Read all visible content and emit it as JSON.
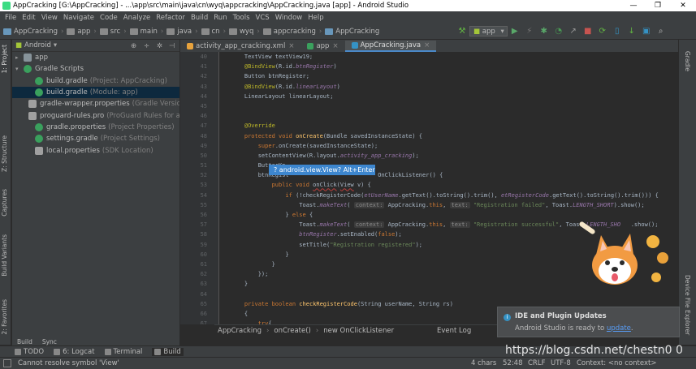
{
  "window": {
    "title": "AppCracking [G:\\AppCracking] - ...\\app\\src\\main\\java\\cn\\wyq\\appcracking\\AppCracking.java [app] - Android Studio",
    "controls": [
      "—",
      "❐",
      "✕"
    ]
  },
  "menu": [
    "File",
    "Edit",
    "View",
    "Navigate",
    "Code",
    "Analyze",
    "Refactor",
    "Build",
    "Run",
    "Tools",
    "VCS",
    "Window",
    "Help"
  ],
  "breadcrumbs": [
    "AppCracking",
    "app",
    "src",
    "main",
    "java",
    "cn",
    "wyq",
    "appcracking",
    "AppCracking"
  ],
  "toolbar": {
    "run_config": "app"
  },
  "project_panel": {
    "view_selector": "Android",
    "tree": [
      {
        "label": "app",
        "sub": "",
        "icon": "folder-icon",
        "indent": 0
      },
      {
        "label": "Gradle Scripts",
        "sub": "",
        "icon": "gradle-icon",
        "indent": 0
      },
      {
        "label": "build.gradle",
        "sub": "(Project: AppCracking)",
        "icon": "gradle-icon",
        "indent": 1
      },
      {
        "label": "build.gradle",
        "sub": "(Module: app)",
        "icon": "gradle-icon",
        "indent": 1
      },
      {
        "label": "gradle-wrapper.properties",
        "sub": "(Gradle Version)",
        "icon": "properties-icon",
        "indent": 1
      },
      {
        "label": "proguard-rules.pro",
        "sub": "(ProGuard Rules for ap",
        "icon": "file-icon",
        "indent": 1
      },
      {
        "label": "gradle.properties",
        "sub": "(Project Properties)",
        "icon": "gradle-icon",
        "indent": 1
      },
      {
        "label": "settings.gradle",
        "sub": "(Project Settings)",
        "icon": "gradle-icon",
        "indent": 1
      },
      {
        "label": "local.properties",
        "sub": "(SDK Location)",
        "icon": "properties-icon",
        "indent": 1
      }
    ],
    "selected_index": 3
  },
  "left_stripe": [
    "1: Project",
    "Z: Structure",
    "Captures",
    "Build Variants",
    "2: Favorites"
  ],
  "right_stripe": [
    "Gradle",
    "Device File Explorer"
  ],
  "build_strip": [
    "Build",
    "Sync"
  ],
  "editor_tabs": [
    {
      "label": "activity_app_cracking.xml",
      "active": false
    },
    {
      "label": "app",
      "active": false
    },
    {
      "label": "AppCracking.java",
      "active": true
    }
  ],
  "line_numbers": [
    "40",
    "41",
    "42",
    "43",
    "44",
    "45",
    "46",
    "47",
    "48",
    "49",
    "50",
    "51",
    "52",
    "53",
    "54",
    "55",
    "56",
    "57",
    "58",
    "59",
    "60",
    "61",
    "62",
    "63",
    "64",
    "65",
    "66",
    "67"
  ],
  "code_lines": [
    [
      {
        "t": "    TextView textView19;",
        "c": ""
      }
    ],
    [
      {
        "t": "    @BindView",
        "c": "ann"
      },
      {
        "t": "(R.id.",
        "c": ""
      },
      {
        "t": "btnRegister",
        "c": "id"
      },
      {
        "t": ")",
        "c": ""
      }
    ],
    [
      {
        "t": "    Button btnRegister;",
        "c": ""
      }
    ],
    [
      {
        "t": "    @BindView",
        "c": "ann"
      },
      {
        "t": "(R.id.",
        "c": ""
      },
      {
        "t": "linearLayout",
        "c": "id"
      },
      {
        "t": ")",
        "c": ""
      }
    ],
    [
      {
        "t": "    LinearLayout linearLayout;",
        "c": ""
      }
    ],
    [
      {
        "t": "",
        "c": ""
      }
    ],
    [
      {
        "t": "",
        "c": ""
      }
    ],
    [
      {
        "t": "    @Override",
        "c": "ann"
      }
    ],
    [
      {
        "t": "    protected void ",
        "c": "kw"
      },
      {
        "t": "onCreate",
        "c": "fn"
      },
      {
        "t": "(Bundle savedInstanceState) {",
        "c": ""
      }
    ],
    [
      {
        "t": "        super",
        "c": "kw"
      },
      {
        "t": ".onCreate(savedInstanceState);",
        "c": ""
      }
    ],
    [
      {
        "t": "        setContentView(R.layout.",
        "c": ""
      },
      {
        "t": "activity_app_cracking",
        "c": "id"
      },
      {
        "t": ");",
        "c": ""
      }
    ],
    [
      {
        "t": "        ButterKn",
        "c": ""
      }
    ],
    [
      {
        "t": "        btnRegist",
        "c": ""
      },
      {
        "t": "                          ",
        "c": ""
      },
      {
        "t": "OnClickListener() {",
        "c": ""
      }
    ],
    [
      {
        "t": "            public void ",
        "c": "kw"
      },
      {
        "t": "onClick",
        "c": "err"
      },
      {
        "t": "(",
        "c": ""
      },
      {
        "t": "View",
        "c": "err"
      },
      {
        "t": " v) {",
        "c": ""
      }
    ],
    [
      {
        "t": "                if ",
        "c": "kw"
      },
      {
        "t": "(!checkRegisterCode(",
        "c": ""
      },
      {
        "t": "etUserName",
        "c": "id"
      },
      {
        "t": ".getText().toString().trim(), ",
        "c": ""
      },
      {
        "t": "etRegisterCode",
        "c": "id"
      },
      {
        "t": ".getText().toString().trim())) {",
        "c": ""
      }
    ],
    [
      {
        "t": "                    Toast.",
        "c": ""
      },
      {
        "t": "makeText",
        "c": "id"
      },
      {
        "t": "( ",
        "c": ""
      },
      {
        "t": "context:",
        "c": "hint"
      },
      {
        "t": " AppCracking.",
        "c": ""
      },
      {
        "t": "this",
        "c": "kw"
      },
      {
        "t": ", ",
        "c": ""
      },
      {
        "t": "text:",
        "c": "hint"
      },
      {
        "t": " ",
        "c": ""
      },
      {
        "t": "\"Registration failed\"",
        "c": "str"
      },
      {
        "t": ", Toast.",
        "c": ""
      },
      {
        "t": "LENGTH_SHORT",
        "c": "id"
      },
      {
        "t": ").show();",
        "c": ""
      }
    ],
    [
      {
        "t": "                } ",
        "c": ""
      },
      {
        "t": "else ",
        "c": "kw"
      },
      {
        "t": "{",
        "c": ""
      }
    ],
    [
      {
        "t": "                    Toast.",
        "c": ""
      },
      {
        "t": "makeText",
        "c": "id"
      },
      {
        "t": "( ",
        "c": ""
      },
      {
        "t": "context:",
        "c": "hint"
      },
      {
        "t": " AppCracking.",
        "c": ""
      },
      {
        "t": "this",
        "c": "kw"
      },
      {
        "t": ", ",
        "c": ""
      },
      {
        "t": "text:",
        "c": "hint"
      },
      {
        "t": " ",
        "c": ""
      },
      {
        "t": "\"Registration successful\"",
        "c": "str"
      },
      {
        "t": ", Toast.",
        "c": ""
      },
      {
        "t": "LENGTH_SHO",
        "c": "id"
      },
      {
        "t": "   .show();",
        "c": ""
      }
    ],
    [
      {
        "t": "                    ",
        "c": ""
      },
      {
        "t": "btnRegister",
        "c": "id"
      },
      {
        "t": ".setEnabled(",
        "c": ""
      },
      {
        "t": "false",
        "c": "kw"
      },
      {
        "t": ");",
        "c": ""
      }
    ],
    [
      {
        "t": "                    setTitle(",
        "c": ""
      },
      {
        "t": "\"Registration registered\"",
        "c": "str"
      },
      {
        "t": ");",
        "c": ""
      }
    ],
    [
      {
        "t": "                }",
        "c": ""
      }
    ],
    [
      {
        "t": "            }",
        "c": ""
      }
    ],
    [
      {
        "t": "        });",
        "c": ""
      }
    ],
    [
      {
        "t": "    }",
        "c": ""
      }
    ],
    [
      {
        "t": "",
        "c": ""
      }
    ],
    [
      {
        "t": "    private boolean ",
        "c": "kw"
      },
      {
        "t": "checkRegisterCode",
        "c": "fn"
      },
      {
        "t": "(String userName, String rs)",
        "c": ""
      }
    ],
    [
      {
        "t": "    {",
        "c": ""
      }
    ],
    [
      {
        "t": "        try",
        "c": "kw"
      },
      {
        "t": "{",
        "c": ""
      }
    ]
  ],
  "tooltip": "? android.view.View? Alt+Enter",
  "editor_breadcrumb": [
    "AppCracking",
    "onCreate()",
    "new OnClickListener"
  ],
  "event_log": "Event Log",
  "notification": {
    "title": "IDE and Plugin Updates",
    "body": "Android Studio is ready to ",
    "link": "update",
    "suffix": "."
  },
  "bottom_tools": [
    {
      "label": "TODO",
      "icon": "todo-icon",
      "active": false
    },
    {
      "label": "6: Logcat",
      "icon": "logcat-icon",
      "active": false
    },
    {
      "label": "Terminal",
      "icon": "terminal-icon",
      "active": false
    },
    {
      "label": "Build",
      "icon": "build-icon",
      "active": true
    }
  ],
  "status": {
    "message": "Cannot resolve symbol 'View'",
    "chars": "4 chars",
    "position": "52:48",
    "line_sep": "CRLF",
    "encoding": "UTF-8",
    "context": "Context: <no context>"
  },
  "watermark": "https://blog.csdn.net/chestn0 0",
  "colors": {
    "accent": "#4a88c7",
    "tooltip_bg": "#3d86ce",
    "panel": "#3c3f41",
    "editor": "#2b2b2b"
  }
}
